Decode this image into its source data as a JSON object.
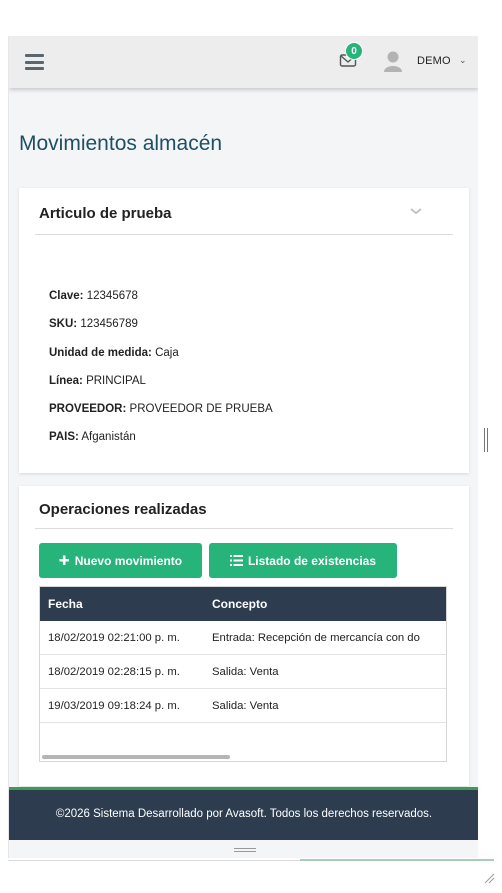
{
  "header": {
    "mail_count": "0",
    "user_name": "DEMO",
    "user_caret": "⌄"
  },
  "page": {
    "title": "Movimientos almacén"
  },
  "article": {
    "name": "Articulo de prueba",
    "fields": [
      {
        "label": "Clave:",
        "value": "12345678"
      },
      {
        "label": "SKU:",
        "value": "123456789"
      },
      {
        "label": "Unidad de medida:",
        "value": "Caja"
      },
      {
        "label": "Línea:",
        "value": "PRINCIPAL"
      },
      {
        "label": "PROVEEDOR:",
        "value": "PROVEEDOR DE PRUEBA"
      },
      {
        "label": "PAIS:",
        "value": "Afganistán"
      }
    ]
  },
  "operations": {
    "title": "Operaciones realizadas",
    "new_button": "Nuevo movimiento",
    "list_button": "Listado de existencias",
    "columns": [
      "Fecha",
      "Concepto"
    ],
    "rows": [
      [
        "18/02/2019 02:21:00 p. m.",
        "Entrada: Recepción de mercancía con do"
      ],
      [
        "18/02/2019 02:28:15 p. m.",
        "Salida: Venta"
      ],
      [
        "19/03/2019 09:18:24 p. m.",
        "Salida: Venta"
      ]
    ]
  },
  "footer": {
    "text": "©2026 Sistema Desarrollado por Avasoft. Todos los derechos reservados."
  },
  "colors": {
    "accent": "#26b47a",
    "table_header": "#2d3d4f",
    "title": "#1f4f63"
  },
  "icons": [
    "menu-icon",
    "mail-icon",
    "user-avatar-icon",
    "chevron-down-icon",
    "plus-icon",
    "list-icon",
    "resize-grip-icon"
  ]
}
